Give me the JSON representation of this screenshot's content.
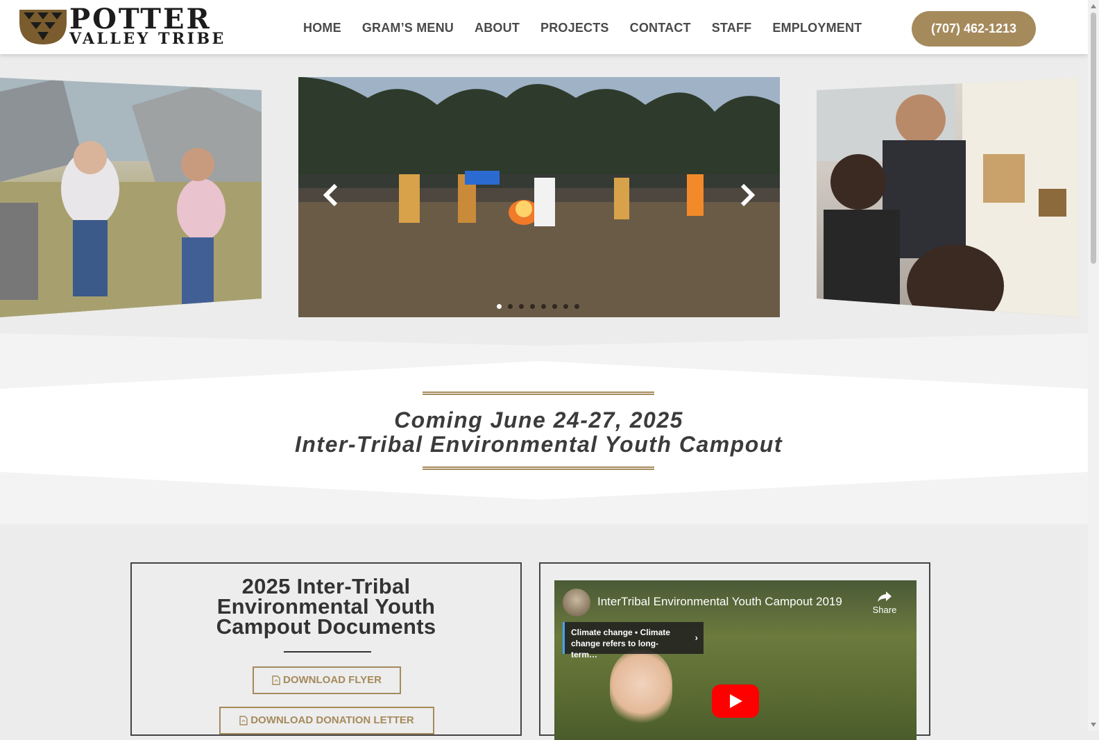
{
  "brand": {
    "line1": "POTTER",
    "line2": "VALLEY TRIBE",
    "gold": "#a58a5c"
  },
  "nav": {
    "items": [
      {
        "label": "HOME",
        "name": "nav-home"
      },
      {
        "label": "GRAM’S MENU",
        "name": "nav-grams-menu"
      },
      {
        "label": "ABOUT",
        "name": "nav-about"
      },
      {
        "label": "PROJECTS",
        "name": "nav-projects"
      },
      {
        "label": "CONTACT",
        "name": "nav-contact"
      },
      {
        "label": "STAFF",
        "name": "nav-staff"
      },
      {
        "label": "EMPLOYMENT",
        "name": "nav-employment"
      }
    ],
    "phone": "(707) 462-1213"
  },
  "carousel": {
    "slide_count": 8,
    "active_index": 0,
    "prev_icon": "chevron-left-icon",
    "next_icon": "chevron-right-icon"
  },
  "banner": {
    "line1": "Coming June 24-27, 2025",
    "line2": "Inter-Tribal Environmental Youth Campout"
  },
  "documents": {
    "title_lines": [
      "2025 Inter-Tribal",
      "Environmental Youth",
      "Campout Documents"
    ],
    "buttons": [
      {
        "label": "DOWNLOAD FLYER",
        "icon": "pdf-file-icon"
      },
      {
        "label": "DOWNLOAD DONATION LETTER",
        "icon": "pdf-file-icon"
      }
    ]
  },
  "video": {
    "title": "InterTribal Environmental Youth Campout 2019",
    "share_label": "Share",
    "info_card_text": "Climate change • Climate change refers to long-term…",
    "play_color": "#ff0000"
  }
}
